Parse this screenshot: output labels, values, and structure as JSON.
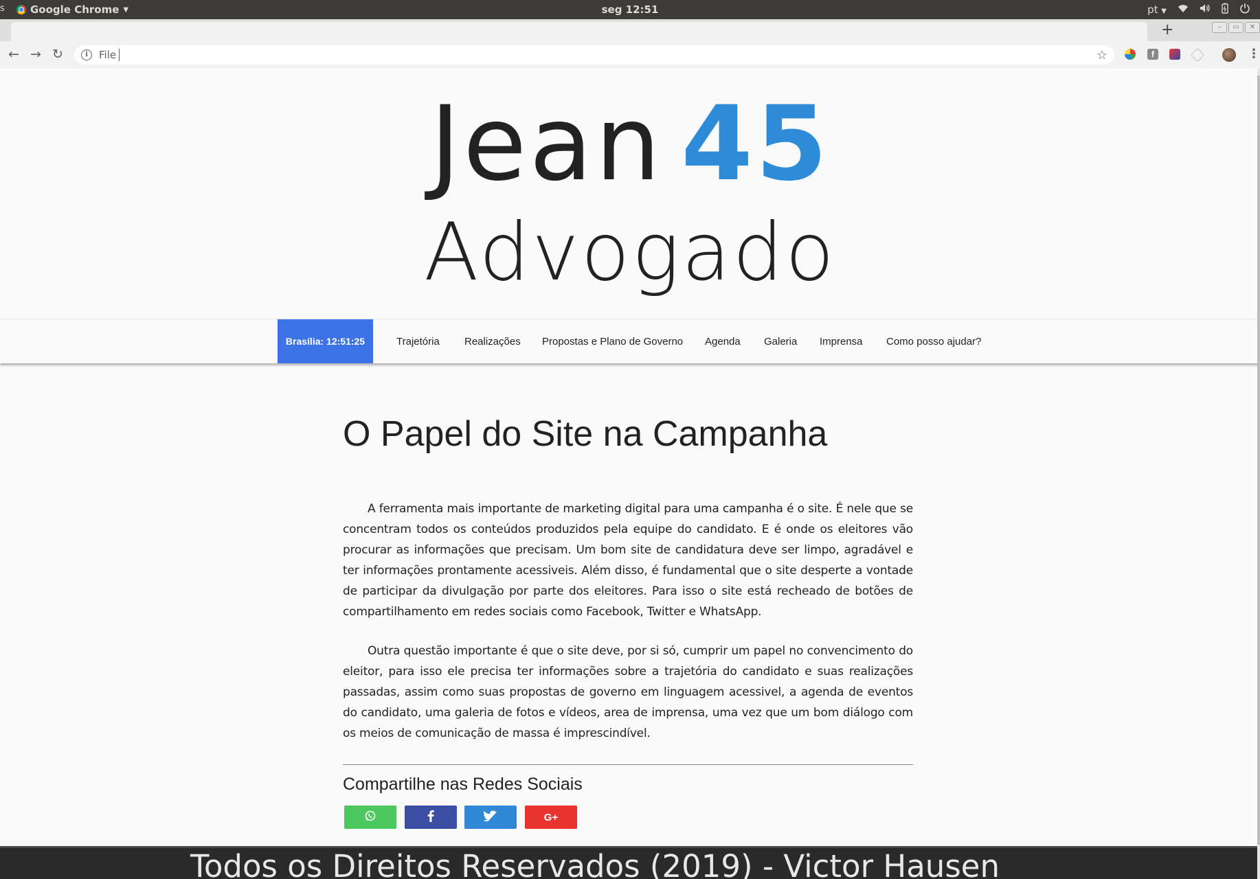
{
  "os_panel": {
    "app_name": "Google Chrome",
    "clock": "seg 12:51",
    "keyboard_layout": "pt",
    "icons": [
      "wifi-icon",
      "volume-icon",
      "battery-icon",
      "power-icon"
    ]
  },
  "browser": {
    "new_tab_label": "+",
    "url_scheme_label": "File",
    "url": "",
    "extension_icons": [
      "colorful-extension-icon",
      "facebook-extension-icon",
      "red-extension-icon",
      "gray-extension-icon"
    ]
  },
  "hero": {
    "name": "Jean",
    "number": "45",
    "profession": "Advogado",
    "accent_color": "#2e8bd8"
  },
  "nav": {
    "clock_label": "Brasília: 12:51:25",
    "clock_bg": "#3d72e6",
    "items": [
      "Trajetória",
      "Realizações",
      "Propostas e Plano de Governo",
      "Agenda",
      "Galeria",
      "Imprensa",
      "Como posso ajudar?"
    ]
  },
  "article": {
    "title": "O Papel do Site na Campanha",
    "paragraphs": [
      "A ferramenta mais importante de marketing digital para uma campanha é o site. É nele que se concentram todos os conteúdos produzidos pela equipe do candidato. E é onde os eleitores vão procurar as informações que precisam. Um bom site de candidatura deve ser limpo, agradável e ter informações prontamente acessiveis. Além disso, é fundamental que o site desperte a vontade de participar da divulgação por parte dos eleitores. Para isso o site está recheado de botões de compartilhamento em redes sociais como Facebook, Twitter e WhatsApp.",
      "Outra questão importante é que o site deve, por si só, cumprir um papel no convencimento do eleitor, para isso ele precisa ter informações sobre a trajetória do candidato e suas realizações passadas, assim como suas propostas de governo em linguagem acessivel, a agenda de eventos do candidato, uma galeria de fotos e vídeos, area de imprensa, uma vez que um bom diálogo com os meios de comunicação de massa é imprescindível."
    ]
  },
  "share": {
    "title": "Compartilhe nas Redes Sociais",
    "buttons": [
      {
        "icon": "whatsapp-icon",
        "color": "#4cc85f"
      },
      {
        "icon": "facebook-icon",
        "color": "#3b4ea3"
      },
      {
        "icon": "twitter-icon",
        "color": "#3088d6"
      },
      {
        "icon": "google-plus-icon",
        "glyph": "G+",
        "color": "#e8332f"
      }
    ]
  },
  "footer": {
    "text": "Todos os Direitos Reservados (2019) - Victor Hausen"
  }
}
